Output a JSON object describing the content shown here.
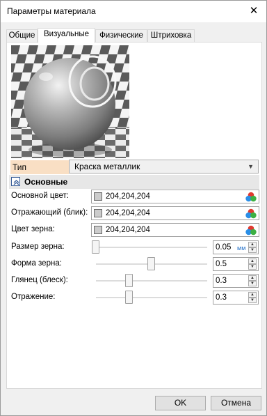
{
  "window": {
    "title": "Параметры материала",
    "close_glyph": "✕"
  },
  "tabs": [
    {
      "label": "Общие",
      "active": false
    },
    {
      "label": "Визуальные",
      "active": true
    },
    {
      "label": "Физические",
      "active": false
    },
    {
      "label": "Штриховка",
      "active": false
    }
  ],
  "material": {
    "type_label": "Тип материала:",
    "type_value": "Краска металлик"
  },
  "section": {
    "title": "Основные",
    "icon": "collapse-up-icon"
  },
  "colors": [
    {
      "label": "Основной цвет:",
      "value": "204,204,204",
      "swatch": "#cccccc"
    },
    {
      "label": "Отражающий (блик):",
      "value": "204,204,204",
      "swatch": "#cccccc"
    },
    {
      "label": "Цвет зерна:",
      "value": "204,204,204",
      "swatch": "#cccccc"
    }
  ],
  "sliders": [
    {
      "label": "Размер зерна:",
      "value": "0.05",
      "unit": "мм",
      "level": 0.0
    },
    {
      "label": "Форма зерна:",
      "value": "0.5",
      "unit": "",
      "level": 0.5
    },
    {
      "label": "Глянец (блеск):",
      "value": "0.3",
      "unit": "",
      "level": 0.3
    },
    {
      "label": "Отражение:",
      "value": "0.3",
      "unit": "",
      "level": 0.3
    }
  ],
  "buttons": {
    "ok": "OK",
    "cancel": "Отмена"
  },
  "accent_colors": {
    "label_highlight": "#f9dfc4",
    "unit_blue": "#2672c9"
  }
}
